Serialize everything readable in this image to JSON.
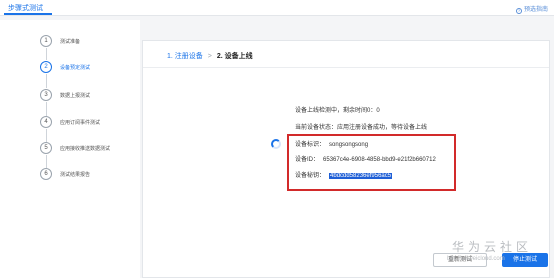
{
  "header": {
    "title": "步骤式测试",
    "help_label": "预选指南"
  },
  "steps": [
    {
      "num": "1",
      "label": "测试准备",
      "state": "done"
    },
    {
      "num": "2",
      "label": "设备预定测试",
      "state": "active"
    },
    {
      "num": "3",
      "label": "数据上报测试",
      "state": "pending"
    },
    {
      "num": "4",
      "label": "应用订阅事件测试",
      "state": "pending"
    },
    {
      "num": "5",
      "label": "应用接收推送数据测试",
      "state": "pending"
    },
    {
      "num": "6",
      "label": "测试结果报告",
      "state": "pending"
    }
  ],
  "tabs": {
    "tab1": "1. 注册设备",
    "separator": ">",
    "tab2": "2. 设备上线"
  },
  "status": {
    "countdown": "设备上线检测中，剩余时间0：0",
    "state": "当前设备状态：应用注册设备成功，等待设备上线"
  },
  "device": {
    "id_label": "设备标识：",
    "id_value": "songsongsong",
    "devid_label": "设备ID：",
    "devid_value": "65367c4e-6908-4858-bbd9-e21f2b660712",
    "secret_label": "设备秘钥：",
    "secret_value": "4bdcdd58236ef956ac5"
  },
  "buttons": {
    "reset": "重新测试",
    "stop": "停止测试"
  },
  "watermark": {
    "text": "华为云社区",
    "url": "bbs.huaweicloud.com"
  },
  "colors": {
    "accent": "#1a73e8",
    "highlight_box": "#d22a2a",
    "selection": "#1f5fd6"
  }
}
